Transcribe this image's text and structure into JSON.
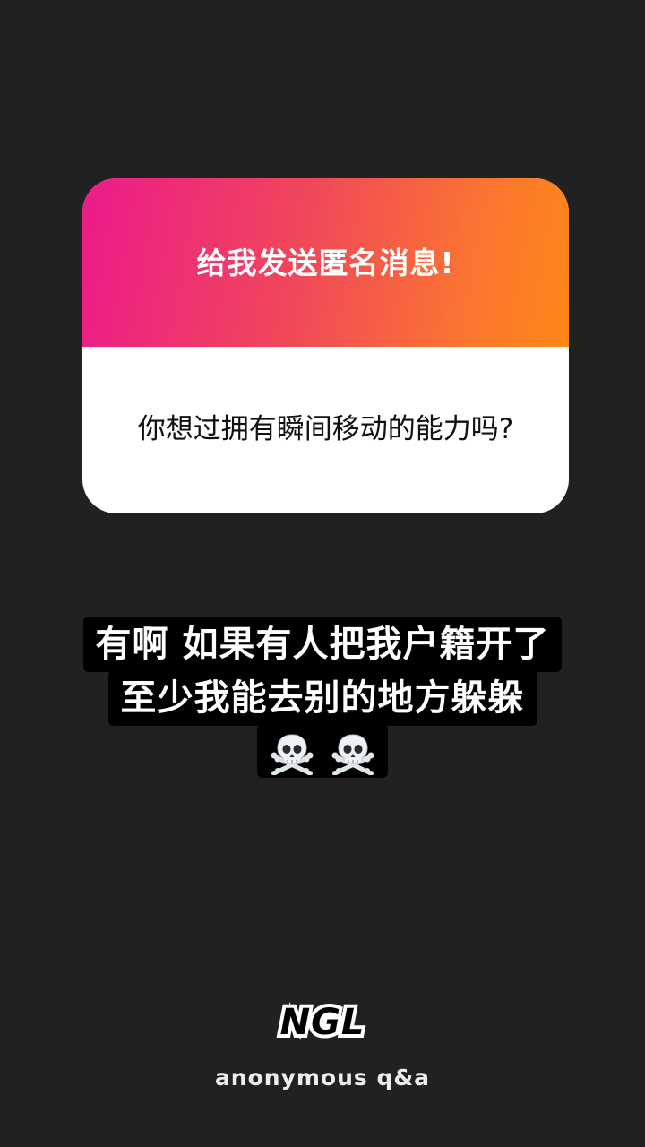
{
  "card": {
    "header_text": "给我发送匿名消息!",
    "question": "你想过拥有瞬间移动的能力吗?"
  },
  "reply": {
    "line1": "有啊 如果有人把我户籍开了",
    "line2": "至少我能去别的地方躲躲",
    "emojis": [
      "skull-and-crossbones-icon",
      "skull-and-crossbones-icon"
    ]
  },
  "footer": {
    "logo": "NGL",
    "caption": "anonymous q&a"
  },
  "colors": {
    "background": "#212121",
    "gradient_start": "#ec1a8a",
    "gradient_end": "#fe8718",
    "card_body": "#ffffff",
    "caption_bg": "#000000"
  }
}
